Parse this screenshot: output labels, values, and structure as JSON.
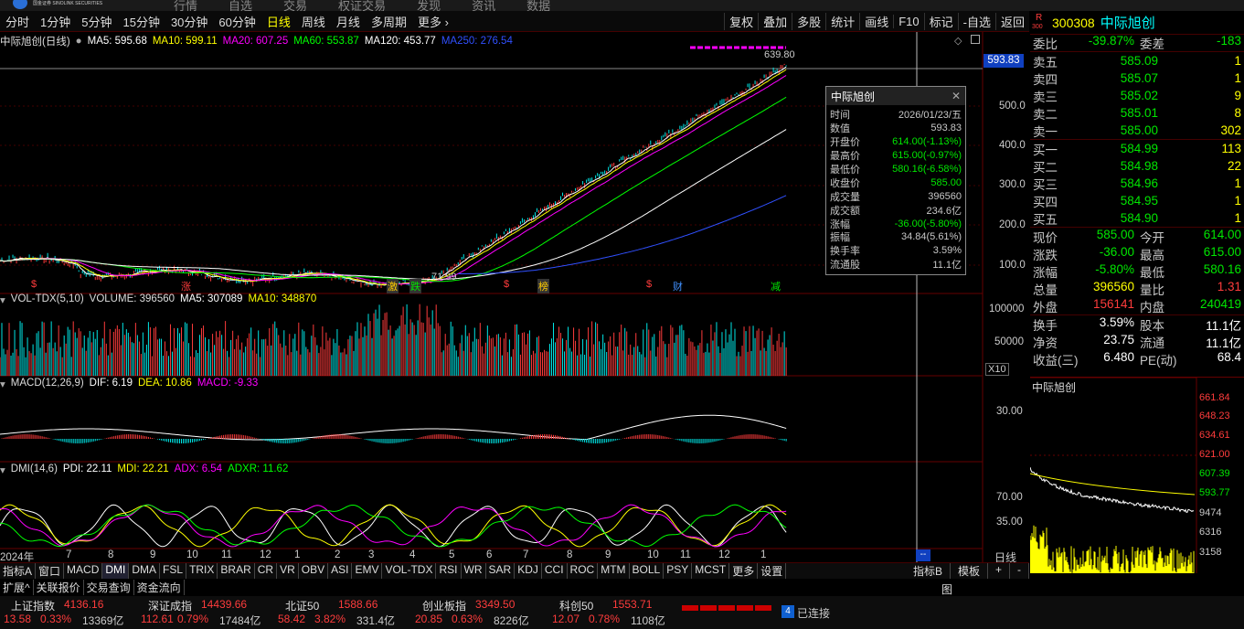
{
  "header": {
    "menu": [
      "行情",
      "自选",
      "交易",
      "权证交易",
      "发现",
      "资讯",
      "数据"
    ],
    "brand": "国金证券 SINOLINK SECURITIES"
  },
  "period_tabs": [
    "分时",
    "1分钟",
    "5分钟",
    "15分钟",
    "30分钟",
    "60分钟",
    "日线",
    "周线",
    "月线",
    "多周期",
    "更多 ›"
  ],
  "active_period": "日线",
  "tools": [
    "复权",
    "叠加",
    "多股",
    "统计",
    "画线",
    "F10",
    "标记",
    "-自选",
    "返回"
  ],
  "main_pane": {
    "title": "中际旭创(日线)",
    "ma": [
      {
        "label": "MA5: 595.68",
        "color": "#ffffff"
      },
      {
        "label": "MA10: 599.11",
        "color": "#ffff00"
      },
      {
        "label": "MA20: 607.25",
        "color": "#ff00ff"
      },
      {
        "label": "MA60: 553.87",
        "color": "#00ff00"
      },
      {
        "label": "MA120: 453.77",
        "color": "#ffffff"
      },
      {
        "label": "MA250: 276.54",
        "color": "#3050ff"
      }
    ],
    "price_tag": "593.83",
    "high_label": "639.80",
    "low_label": "71.99",
    "yaxis": [
      "500.0",
      "400.0",
      "300.0",
      "200.0",
      "100.0"
    ],
    "markers": [
      {
        "text": "$",
        "color": "#ff3c3c"
      },
      {
        "text": "涨",
        "color": "#ff3c3c"
      },
      {
        "text": "激",
        "color": "#ffcc00"
      },
      {
        "text": "跌",
        "color": "#00e600"
      },
      {
        "text": "$",
        "color": "#ff3c3c"
      },
      {
        "text": "榜",
        "color": "#ffcc00"
      },
      {
        "text": "$",
        "color": "#ff3c3c"
      },
      {
        "text": "财",
        "color": "#4090ff"
      },
      {
        "text": "减",
        "color": "#00e600"
      }
    ]
  },
  "info_box": {
    "title": "中际旭创",
    "rows": [
      {
        "k": "时间",
        "v": "2026/01/23/五",
        "c": "#c8c8c8"
      },
      {
        "k": "数值",
        "v": "593.83",
        "c": "#c8c8c8"
      },
      {
        "k": "开盘价",
        "v": "614.00(-1.13%)",
        "c": "#00e600"
      },
      {
        "k": "最高价",
        "v": "615.00(-0.97%)",
        "c": "#00e600"
      },
      {
        "k": "最低价",
        "v": "580.16(-6.58%)",
        "c": "#00e600"
      },
      {
        "k": "收盘价",
        "v": "585.00",
        "c": "#00e600"
      },
      {
        "k": "成交量",
        "v": "396560",
        "c": "#c8c8c8"
      },
      {
        "k": "成交额",
        "v": "234.6亿",
        "c": "#c8c8c8"
      },
      {
        "k": "涨幅",
        "v": "-36.00(-5.80%)",
        "c": "#00e600"
      },
      {
        "k": "振幅",
        "v": "34.84(5.61%)",
        "c": "#c8c8c8"
      },
      {
        "k": "换手率",
        "v": "3.59%",
        "c": "#c8c8c8"
      },
      {
        "k": "流通股",
        "v": "11.1亿",
        "c": "#c8c8c8"
      }
    ]
  },
  "vol_pane": {
    "title": "VOL-TDX(5,10)",
    "volume": "VOLUME: 396560",
    "ma5": "MA5: 307089",
    "ma10": "MA10: 348870",
    "yaxis": [
      "100000",
      "50000"
    ],
    "unit": "X10"
  },
  "macd_pane": {
    "title": "MACD(12,26,9)",
    "dif": "DIF: 6.19",
    "dea": "DEA: 10.86",
    "macd": "MACD: -9.33",
    "yaxis": [
      "30.00"
    ]
  },
  "dmi_pane": {
    "title": "DMI(14,6)",
    "pdi": "PDI: 22.11",
    "mdi": "MDI: 22.21",
    "adx": "ADX: 6.54",
    "adxr": "ADXR: 11.62",
    "yaxis": [
      "70.00",
      "35.00"
    ]
  },
  "xaxis": [
    "2024年",
    "7",
    "8",
    "9",
    "10",
    "11",
    "12",
    "1",
    "2",
    "3",
    "4",
    "5",
    "6",
    "7",
    "8",
    "9",
    "10",
    "11",
    "12",
    "1"
  ],
  "xaxis_unit": "日线",
  "indicator_tabs": [
    "指标A",
    "窗口",
    "MACD",
    "DMI",
    "DMA",
    "FSL",
    "TRIX",
    "BRAR",
    "CR",
    "VR",
    "OBV",
    "ASI",
    "EMV",
    "VOL-TDX",
    "RSI",
    "WR",
    "SAR",
    "KDJ",
    "CCI",
    "ROC",
    "MTM",
    "BOLL",
    "PSY",
    "MCST",
    "更多",
    "设置"
  ],
  "active_indicator": "DMI",
  "indicator_right": [
    "指标B",
    "模板",
    "+",
    "-"
  ],
  "ext_tabs": [
    "扩展^",
    "关联报价",
    "交易查询",
    "资金流向"
  ],
  "quote": {
    "code": "300308",
    "name": "中际旭创",
    "badge_r": "R",
    "badge_num": "300",
    "weibi": {
      "label": "委比",
      "value": "-39.87%",
      "label2": "委差",
      "value2": "-183"
    },
    "sell": [
      {
        "label": "卖五",
        "price": "585.09",
        "vol": "1"
      },
      {
        "label": "卖四",
        "price": "585.07",
        "vol": "1"
      },
      {
        "label": "卖三",
        "price": "585.02",
        "vol": "9"
      },
      {
        "label": "卖二",
        "price": "585.01",
        "vol": "8"
      },
      {
        "label": "卖一",
        "price": "585.00",
        "vol": "302"
      }
    ],
    "buy": [
      {
        "label": "买一",
        "price": "584.99",
        "vol": "113"
      },
      {
        "label": "买二",
        "price": "584.98",
        "vol": "22"
      },
      {
        "label": "买三",
        "price": "584.96",
        "vol": "1"
      },
      {
        "label": "买四",
        "price": "584.95",
        "vol": "1"
      },
      {
        "label": "买五",
        "price": "584.90",
        "vol": "1"
      }
    ],
    "stats": [
      {
        "l1": "现价",
        "v1": "585.00",
        "c1": "#00e600",
        "l2": "今开",
        "v2": "614.00",
        "c2": "#00e600"
      },
      {
        "l1": "涨跌",
        "v1": "-36.00",
        "c1": "#00e600",
        "l2": "最高",
        "v2": "615.00",
        "c2": "#00e600"
      },
      {
        "l1": "涨幅",
        "v1": "-5.80%",
        "c1": "#00e600",
        "l2": "最低",
        "v2": "580.16",
        "c2": "#00e600"
      },
      {
        "l1": "总量",
        "v1": "396560",
        "c1": "#ffff00",
        "l2": "量比",
        "v2": "1.31",
        "c2": "#ff3c3c"
      },
      {
        "l1": "外盘",
        "v1": "156141",
        "c1": "#ff3c3c",
        "l2": "内盘",
        "v2": "240419",
        "c2": "#00e600"
      }
    ],
    "stats2": [
      {
        "l1": "换手",
        "v1": "3.59%",
        "l2": "股本",
        "v2": "11.1亿"
      },
      {
        "l1": "净资",
        "v1": "23.75",
        "l2": "流通",
        "v2": "11.1亿"
      },
      {
        "l1": "收益(三)",
        "v1": "6.480",
        "l2": "PE(动)",
        "v2": "68.4"
      }
    ]
  },
  "mini_chart": {
    "title": "中际旭创",
    "yaxis": [
      "661.84",
      "648.23",
      "634.61",
      "621.00",
      "607.39",
      "593.77",
      "9474",
      "6316",
      "3158"
    ]
  },
  "indices": [
    {
      "name": "上证指数",
      "val": "4136.16",
      "chg": "13.58",
      "pct": "0.33%",
      "amt": "13369亿",
      "col": "#ff3c3c"
    },
    {
      "name": "深证成指",
      "val": "14439.66",
      "chg": "112.61",
      "pct": "0.79%",
      "amt": "17484亿",
      "col": "#ff3c3c"
    },
    {
      "name": "北证50",
      "val": "1588.66",
      "chg": "58.42",
      "pct": "3.82%",
      "amt": "331.4亿",
      "col": "#ff3c3c"
    },
    {
      "name": "创业板指",
      "val": "3349.50",
      "chg": "20.85",
      "pct": "0.63%",
      "amt": "8226亿",
      "col": "#ff3c3c"
    },
    {
      "name": "科创50",
      "val": "1553.71",
      "chg": "12.07",
      "pct": "0.78%",
      "amt": "1108亿",
      "col": "#ff3c3c"
    }
  ],
  "conn": {
    "num": "4",
    "text": "已连接"
  }
}
